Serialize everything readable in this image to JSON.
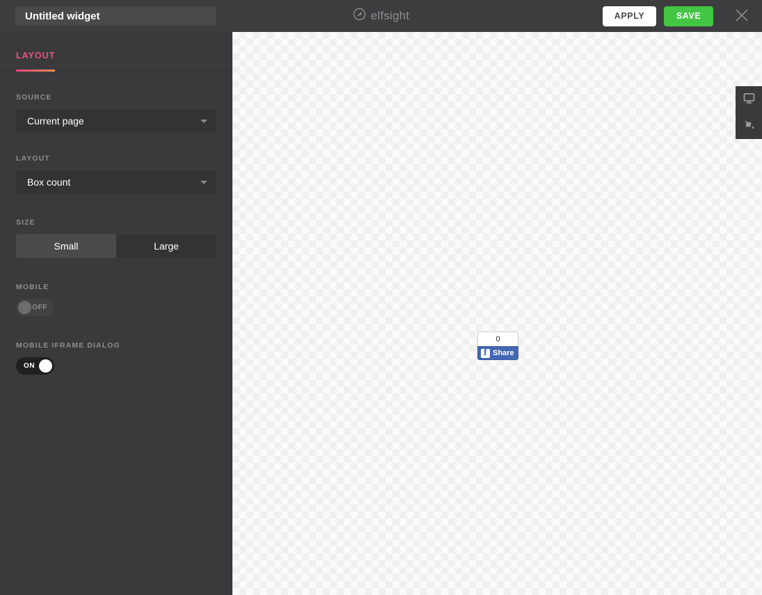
{
  "header": {
    "title_value": "Untitled widget",
    "title_placeholder": "Untitled widget",
    "brand_name": "elfsight",
    "apply_label": "APPLY",
    "save_label": "SAVE",
    "save_color": "#43c643",
    "apply_color": "#ffffff"
  },
  "sidebar": {
    "tabs": [
      {
        "label": "LAYOUT",
        "active": true,
        "accent_start": "#e8437a",
        "accent_end": "#f09050"
      }
    ],
    "fields": {
      "source": {
        "label": "SOURCE",
        "value": "Current page",
        "options": [
          "Current page"
        ]
      },
      "layout": {
        "label": "LAYOUT",
        "value": "Box count",
        "options": [
          "Box count"
        ]
      },
      "size": {
        "label": "SIZE",
        "options": [
          "Small",
          "Large"
        ],
        "selected": "Small"
      },
      "mobile": {
        "label": "MOBILE",
        "state": "OFF"
      },
      "mobile_iframe_dialog": {
        "label": "MOBILE IFRAME DIALOG",
        "state": "ON"
      }
    }
  },
  "canvas": {
    "fb_widget": {
      "count": "0",
      "share_label": "Share",
      "brand_color": "#4267b2"
    }
  },
  "view_toolbar": {
    "buttons": [
      {
        "icon": "desktop-icon"
      },
      {
        "icon": "paint-bucket-icon"
      }
    ]
  }
}
